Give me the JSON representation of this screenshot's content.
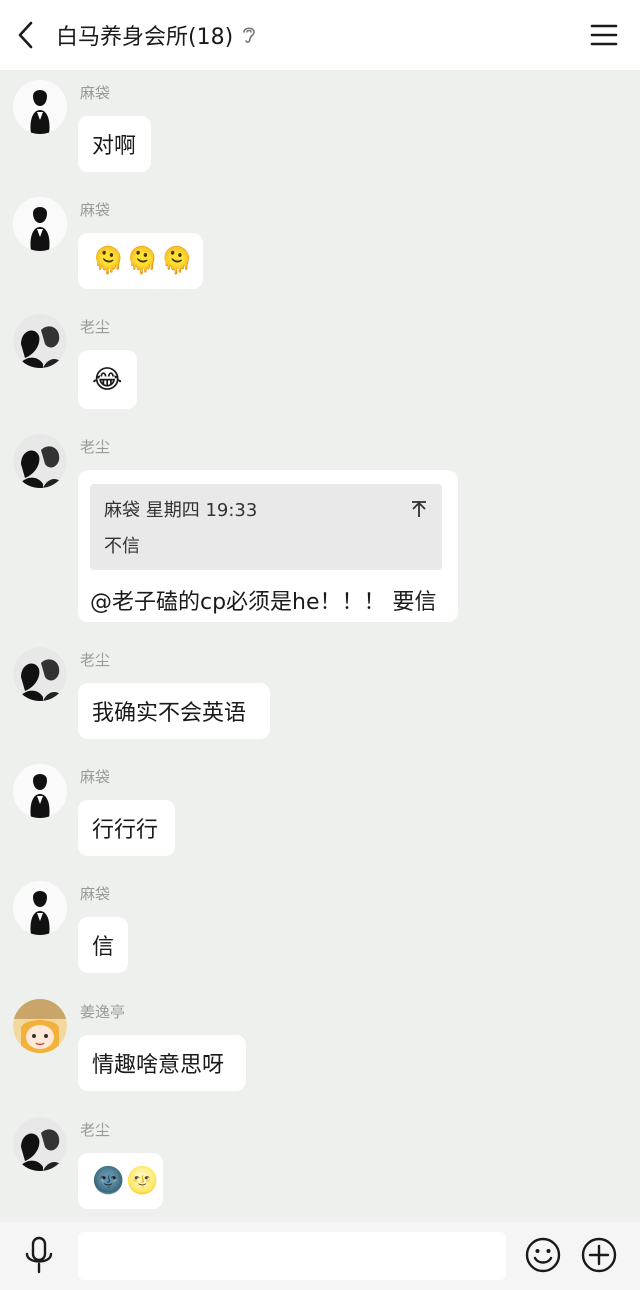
{
  "header": {
    "title": "白马养身会所(18)"
  },
  "messages": [
    {
      "sender": "麻袋",
      "text": "对啊",
      "avatar": "avatar-madai"
    },
    {
      "sender": "麻袋",
      "text": "🫠🫠🫠",
      "avatar": "avatar-madai"
    },
    {
      "sender": "老尘",
      "text": "😂",
      "avatar": "avatar-laochen"
    },
    {
      "sender": "老尘",
      "quote": {
        "author_time": "麻袋 星期四 19:33",
        "text": "不信"
      },
      "text": "@老子磕的cp必须是he！！！ 要信",
      "avatar": "avatar-laochen"
    },
    {
      "sender": "老尘",
      "text": "我确实不会英语",
      "avatar": "avatar-laochen"
    },
    {
      "sender": "麻袋",
      "text": "行行行",
      "avatar": "avatar-madai"
    },
    {
      "sender": "麻袋",
      "text": "信",
      "avatar": "avatar-madai"
    },
    {
      "sender": "姜逸亭",
      "text": "情趣啥意思呀",
      "avatar": "avatar-jiangyiting"
    },
    {
      "sender": "老尘",
      "text": "🌚🌝",
      "avatar": "avatar-laochen"
    }
  ],
  "icons": {
    "back": "chevron-left-icon",
    "ear": "ear-icon",
    "menu": "menu-icon",
    "quote_collapse": "collapse-arrow-icon",
    "mic": "microphone-icon",
    "emoji": "smiley-icon",
    "plus": "plus-icon"
  },
  "colors": {
    "background": "#edf0ed",
    "bubble": "#ffffff",
    "quote": "#e9e9e9",
    "name": "#999a99"
  }
}
